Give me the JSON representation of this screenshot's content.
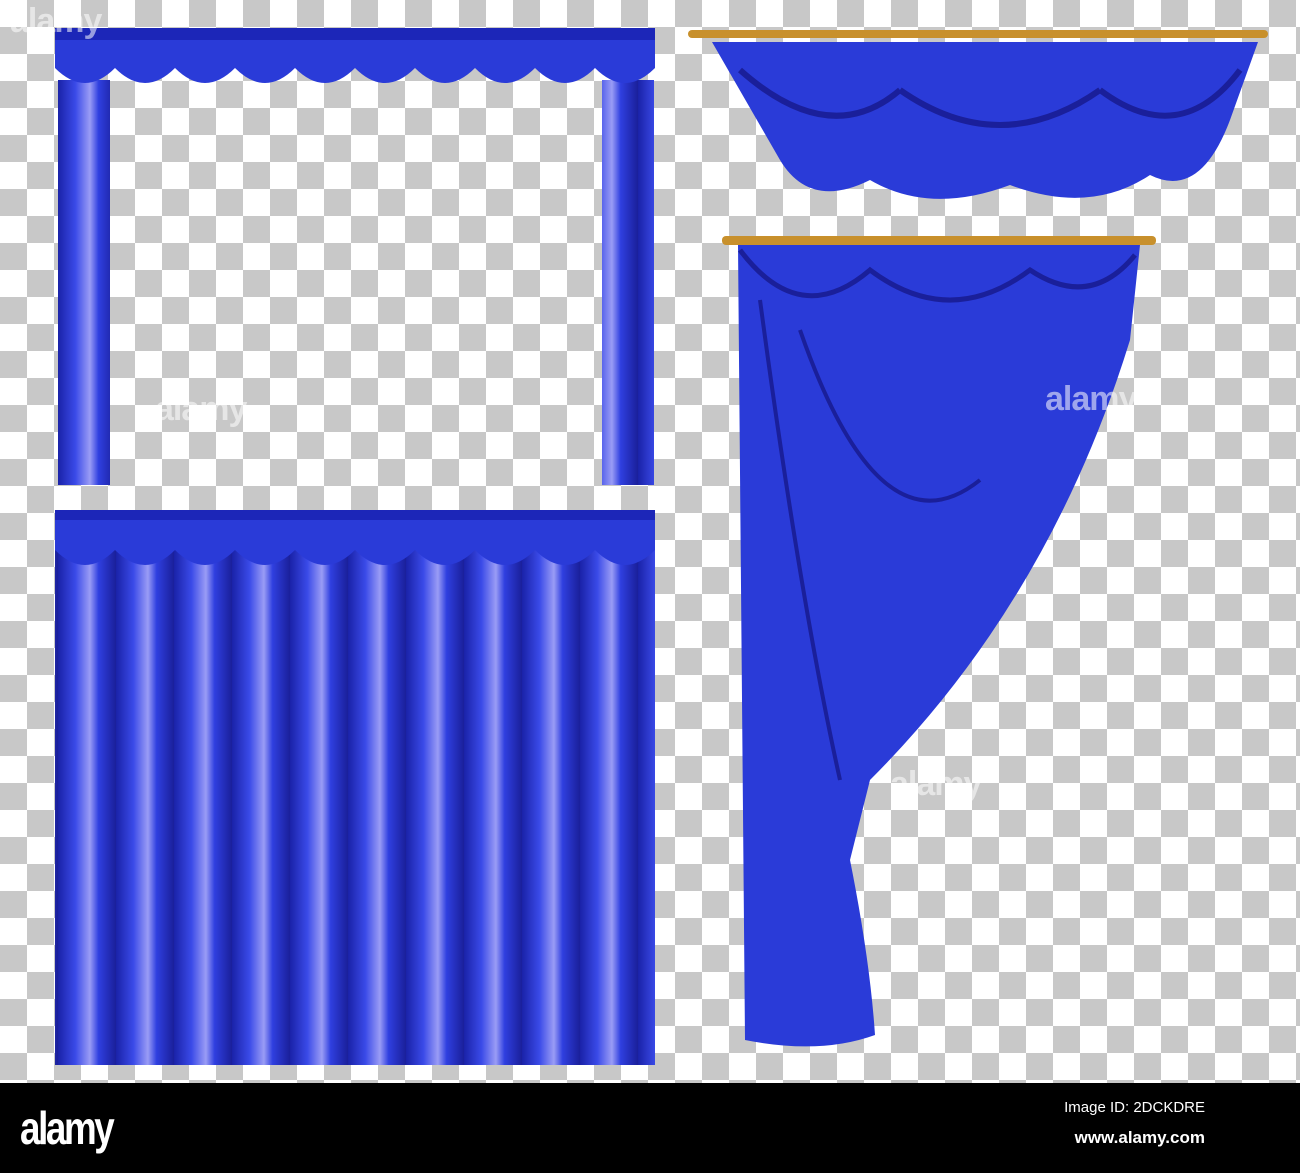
{
  "watermark": "alamy",
  "footer": {
    "logo": "alamy",
    "image_id": "Image ID: 2DCKDRE",
    "site": "www.alamy.com"
  },
  "colors": {
    "curtain": "#2a3bd8",
    "curtain_dark": "#1a1f9a",
    "highlight": "#8a8cf0",
    "rod": "#c8902c"
  }
}
